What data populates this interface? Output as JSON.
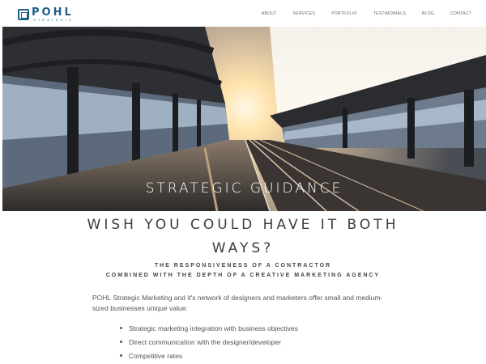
{
  "header": {
    "logo": {
      "name": "POHL",
      "tagline": "STRATEGIC"
    },
    "nav": [
      "ABOUT",
      "SERVICES",
      "PORTFOLIO",
      "TESTIMONIALS",
      "BLOG",
      "CONTACT"
    ]
  },
  "hero": {
    "caption": "STRATEGIC GUIDANCE",
    "image": "train-station-platform-sunset"
  },
  "main": {
    "headline_line1": "WISH YOU COULD HAVE IT BOTH",
    "headline_line2": "WAYS?",
    "subhead_line1": "THE RESPONSIVENESS OF A CONTRACTOR",
    "subhead_line2": "COMBINED WITH THE DEPTH OF A CREATIVE MARKETING AGENCY",
    "intro": "POHL Strategic Marketing and it's network of designers and marketers offer small and medium-sized businesses unique value:",
    "bullets": [
      "Strategic marketing integration with business objectives",
      "Direct communication with the designer/developer",
      "Competitive rates"
    ]
  },
  "colors": {
    "brand": "#1f5f86",
    "text": "#444444"
  }
}
